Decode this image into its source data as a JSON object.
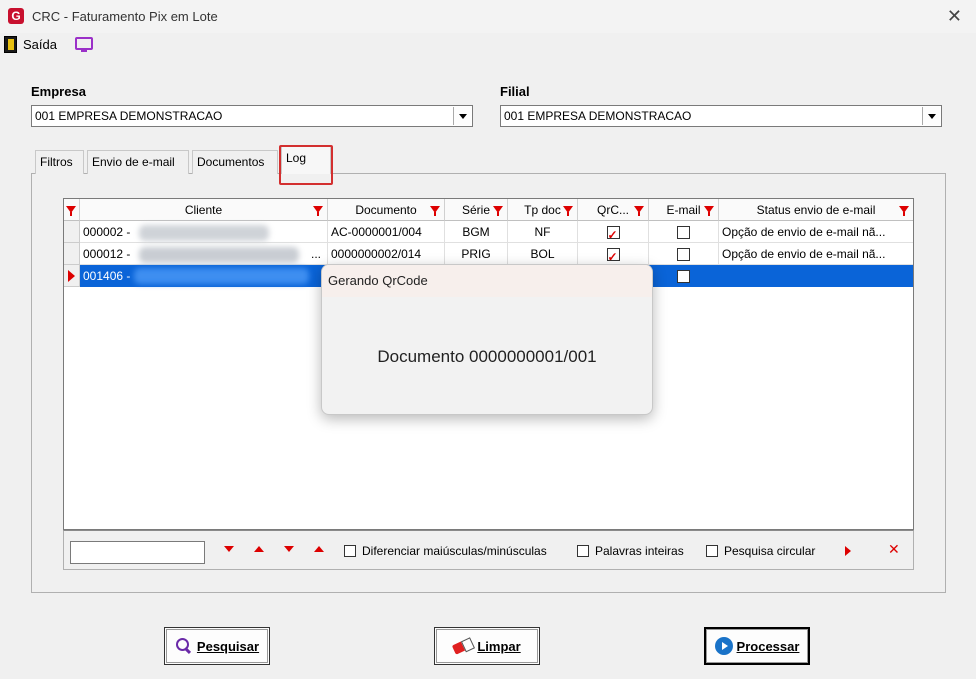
{
  "window": {
    "title": "CRC - Faturamento Pix em Lote",
    "logo_letter": "G"
  },
  "toolbar": {
    "exit_label": "Saída"
  },
  "empresa": {
    "label": "Empresa",
    "value": "001 EMPRESA DEMONSTRACAO"
  },
  "filial": {
    "label": "Filial",
    "value": "001 EMPRESA DEMONSTRACAO"
  },
  "tabs": [
    {
      "label": "Filtros"
    },
    {
      "label": "Envio de e-mail"
    },
    {
      "label": "Documentos"
    },
    {
      "label": "Log",
      "active": true
    }
  ],
  "grid": {
    "columns": [
      "Cliente",
      "Documento",
      "Série",
      "Tp doc",
      "QrC...",
      "E-mail",
      "Status envio de e-mail"
    ],
    "rows": [
      {
        "cliente": "000002 -",
        "documento": "AC-0000001/004",
        "serie": "BGM",
        "tp_doc": "NF",
        "qrcode": true,
        "email": false,
        "status": "Opção de envio de e-mail nã..."
      },
      {
        "cliente": "000012 -",
        "cliente_suffix": "...",
        "documento": "0000000002/014",
        "serie": "PRIG",
        "tp_doc": "BOL",
        "qrcode": true,
        "email": false,
        "status": "Opção de envio de e-mail nã..."
      },
      {
        "cliente": "001406 -",
        "documento": "",
        "serie": "",
        "tp_doc": "",
        "qrcode": false,
        "email": false,
        "status": "",
        "selected": true
      }
    ]
  },
  "search": {
    "case_label": "Diferenciar maiúsculas/minúsculas",
    "whole_label": "Palavras inteiras",
    "circular_label": "Pesquisa circular",
    "close_glyph": "✕"
  },
  "buttons": {
    "search": "Pesquisar",
    "clear": "Limpar",
    "process": "Processar"
  },
  "modal": {
    "title": "Gerando QrCode",
    "message": "Documento 0000000001/001"
  },
  "colors": {
    "selection": "#0a64d8",
    "accent_red": "#dd0000",
    "tab_highlight": "#d32f2f"
  }
}
